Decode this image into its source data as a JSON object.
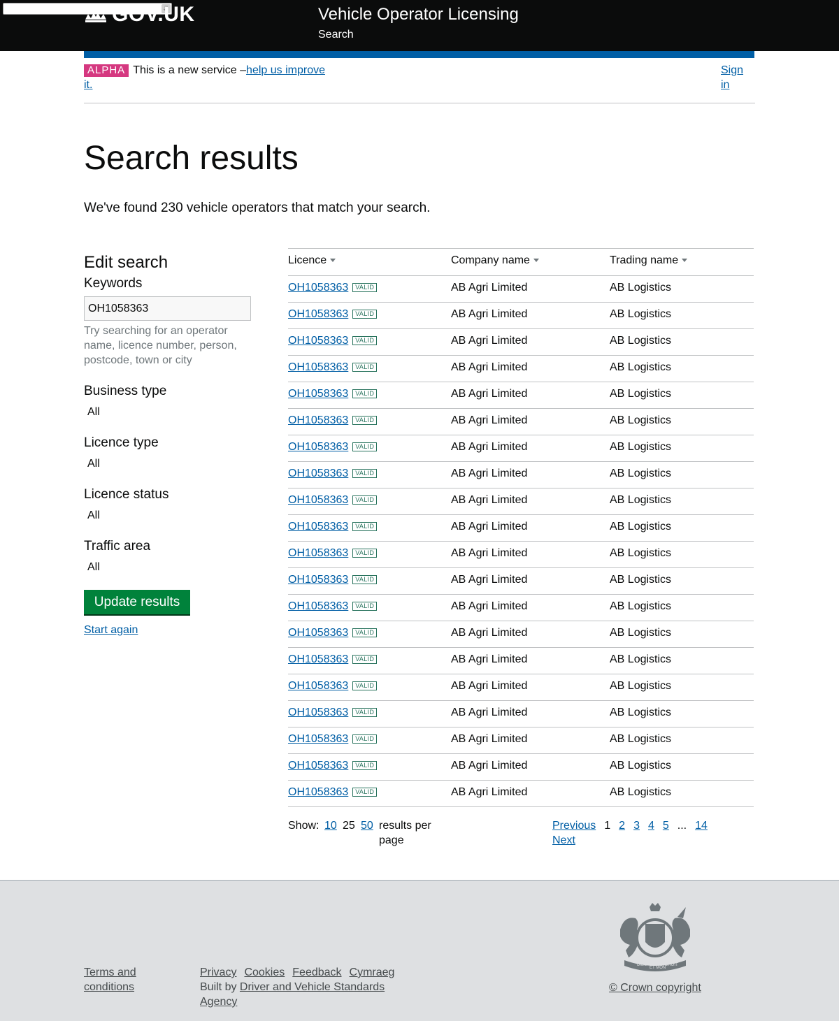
{
  "header": {
    "logo_text": "GOV.UK",
    "service_name": "Vehicle Operator Licensing",
    "service_sub": "Search"
  },
  "phase": {
    "tag": "ALPHA",
    "text": "This is a new service –",
    "link": "help us improve it.",
    "sign_in": "Sign in"
  },
  "page": {
    "title": "Search results",
    "summary": "We've found 230 vehicle operators that match your search."
  },
  "sidebar": {
    "title": "Edit search",
    "keywords_label": "Keywords",
    "keywords_value": "OH1058363",
    "hint": "Try searching for an operator name, licence number, person, postcode, town or city",
    "filters": [
      {
        "label": "Business type",
        "value": "All"
      },
      {
        "label": "Licence type",
        "value": "All"
      },
      {
        "label": "Licence status",
        "value": "All"
      },
      {
        "label": "Traffic area",
        "value": "All"
      }
    ],
    "update_button": "Update results",
    "start_again": "Start again"
  },
  "table": {
    "headers": [
      "Licence",
      "Company name",
      "Trading name"
    ],
    "status_tag": "VALID",
    "rows": [
      {
        "licence": "OH1058363",
        "company": "AB Agri Limited",
        "trading": "AB Logistics"
      },
      {
        "licence": "OH1058363",
        "company": "AB Agri Limited",
        "trading": "AB Logistics"
      },
      {
        "licence": "OH1058363",
        "company": "AB Agri Limited",
        "trading": "AB Logistics"
      },
      {
        "licence": "OH1058363",
        "company": "AB Agri Limited",
        "trading": "AB Logistics"
      },
      {
        "licence": "OH1058363",
        "company": "AB Agri Limited",
        "trading": "AB Logistics"
      },
      {
        "licence": "OH1058363",
        "company": "AB Agri Limited",
        "trading": "AB Logistics"
      },
      {
        "licence": "OH1058363",
        "company": "AB Agri Limited",
        "trading": "AB Logistics"
      },
      {
        "licence": "OH1058363",
        "company": "AB Agri Limited",
        "trading": "AB Logistics"
      },
      {
        "licence": "OH1058363",
        "company": "AB Agri Limited",
        "trading": "AB Logistics"
      },
      {
        "licence": "OH1058363",
        "company": "AB Agri Limited",
        "trading": "AB Logistics"
      },
      {
        "licence": "OH1058363",
        "company": "AB Agri Limited",
        "trading": "AB Logistics"
      },
      {
        "licence": "OH1058363",
        "company": "AB Agri Limited",
        "trading": "AB Logistics"
      },
      {
        "licence": "OH1058363",
        "company": "AB Agri Limited",
        "trading": "AB Logistics"
      },
      {
        "licence": "OH1058363",
        "company": "AB Agri Limited",
        "trading": "AB Logistics"
      },
      {
        "licence": "OH1058363",
        "company": "AB Agri Limited",
        "trading": "AB Logistics"
      },
      {
        "licence": "OH1058363",
        "company": "AB Agri Limited",
        "trading": "AB Logistics"
      },
      {
        "licence": "OH1058363",
        "company": "AB Agri Limited",
        "trading": "AB Logistics"
      },
      {
        "licence": "OH1058363",
        "company": "AB Agri Limited",
        "trading": "AB Logistics"
      },
      {
        "licence": "OH1058363",
        "company": "AB Agri Limited",
        "trading": "AB Logistics"
      },
      {
        "licence": "OH1058363",
        "company": "AB Agri Limited",
        "trading": "AB Logistics"
      }
    ]
  },
  "per_page": {
    "show_label": "Show:",
    "options": [
      "10",
      "25",
      "50"
    ],
    "current": "25",
    "suffix": "results per page"
  },
  "pagination": {
    "previous": "Previous",
    "pages": [
      "1",
      "2",
      "3",
      "4",
      "5"
    ],
    "current": "1",
    "ellipsis": "...",
    "last": "14",
    "next": "Next"
  },
  "footer": {
    "terms": "Terms and conditions",
    "links": [
      "Privacy",
      "Cookies",
      "Feedback",
      "Cymraeg"
    ],
    "built_by_prefix": "Built by",
    "built_by_link": "Driver and Vehicle Standards Agency",
    "crest_motto": [
      "DIEU",
      "ET MON",
      "DROIT"
    ],
    "copyright": "© Crown copyright"
  },
  "colors": {
    "header_bg": "#0b0c0c",
    "brand_blue": "#005ea5",
    "alpha_pink": "#d53880",
    "button_green": "#00823b",
    "valid_green": "#28735d",
    "footer_bg": "#dee0e2"
  },
  "icons": {
    "logo": "crown-icon",
    "sort": "sort-down-icon",
    "crest": "royal-coat-of-arms-icon"
  }
}
